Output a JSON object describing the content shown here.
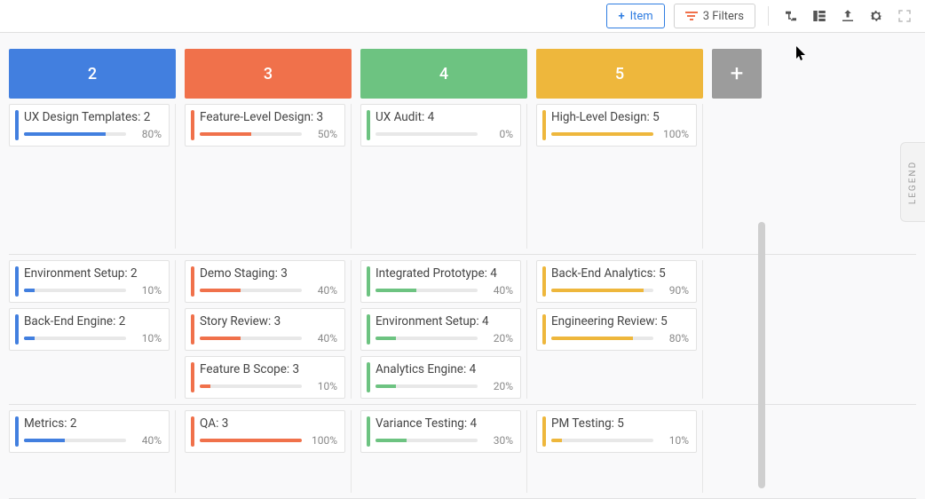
{
  "toolbar": {
    "add_item_label": "Item",
    "filters_label": "3 Filters"
  },
  "legend_label": "LEGEND",
  "columns": [
    {
      "label": "2",
      "color": "blue"
    },
    {
      "label": "3",
      "color": "orange"
    },
    {
      "label": "4",
      "color": "green"
    },
    {
      "label": "5",
      "color": "yellow"
    }
  ],
  "rows": [
    {
      "height": 170,
      "cells": [
        [
          {
            "title": "UX Design Templates:",
            "value": "2",
            "progress": 80,
            "color": "blue"
          }
        ],
        [
          {
            "title": "Feature-Level Design:",
            "value": "3",
            "progress": 50,
            "color": "orange"
          }
        ],
        [
          {
            "title": "UX Audit:",
            "value": "4",
            "progress": 0,
            "color": "green"
          }
        ],
        [
          {
            "title": "High-Level Design:",
            "value": "5",
            "progress": 100,
            "color": "yellow"
          }
        ]
      ]
    },
    {
      "height": 160,
      "cells": [
        [
          {
            "title": "Environment Setup:",
            "value": "2",
            "progress": 10,
            "color": "blue"
          },
          {
            "title": "Back-End Engine:",
            "value": "2",
            "progress": 10,
            "color": "blue"
          }
        ],
        [
          {
            "title": "Demo Staging:",
            "value": "3",
            "progress": 40,
            "color": "orange"
          },
          {
            "title": "Story Review:",
            "value": "3",
            "progress": 40,
            "color": "orange"
          },
          {
            "title": "Feature B Scope:",
            "value": "3",
            "progress": 10,
            "color": "orange"
          }
        ],
        [
          {
            "title": "Integrated Prototype:",
            "value": "4",
            "progress": 40,
            "color": "green"
          },
          {
            "title": "Environment Setup:",
            "value": "4",
            "progress": 20,
            "color": "green"
          },
          {
            "title": "Analytics Engine:",
            "value": "4",
            "progress": 20,
            "color": "green"
          }
        ],
        [
          {
            "title": "Back-End Analytics:",
            "value": "5",
            "progress": 90,
            "color": "yellow"
          },
          {
            "title": "Engineering Review:",
            "value": "5",
            "progress": 80,
            "color": "yellow"
          }
        ]
      ]
    },
    {
      "height": 100,
      "cells": [
        [
          {
            "title": "Metrics:",
            "value": "2",
            "progress": 40,
            "color": "blue"
          }
        ],
        [
          {
            "title": "QA:",
            "value": "3",
            "progress": 100,
            "color": "orange"
          }
        ],
        [
          {
            "title": "Variance Testing:",
            "value": "4",
            "progress": 30,
            "color": "green"
          }
        ],
        [
          {
            "title": "PM Testing:",
            "value": "5",
            "progress": 10,
            "color": "yellow"
          }
        ]
      ]
    }
  ]
}
